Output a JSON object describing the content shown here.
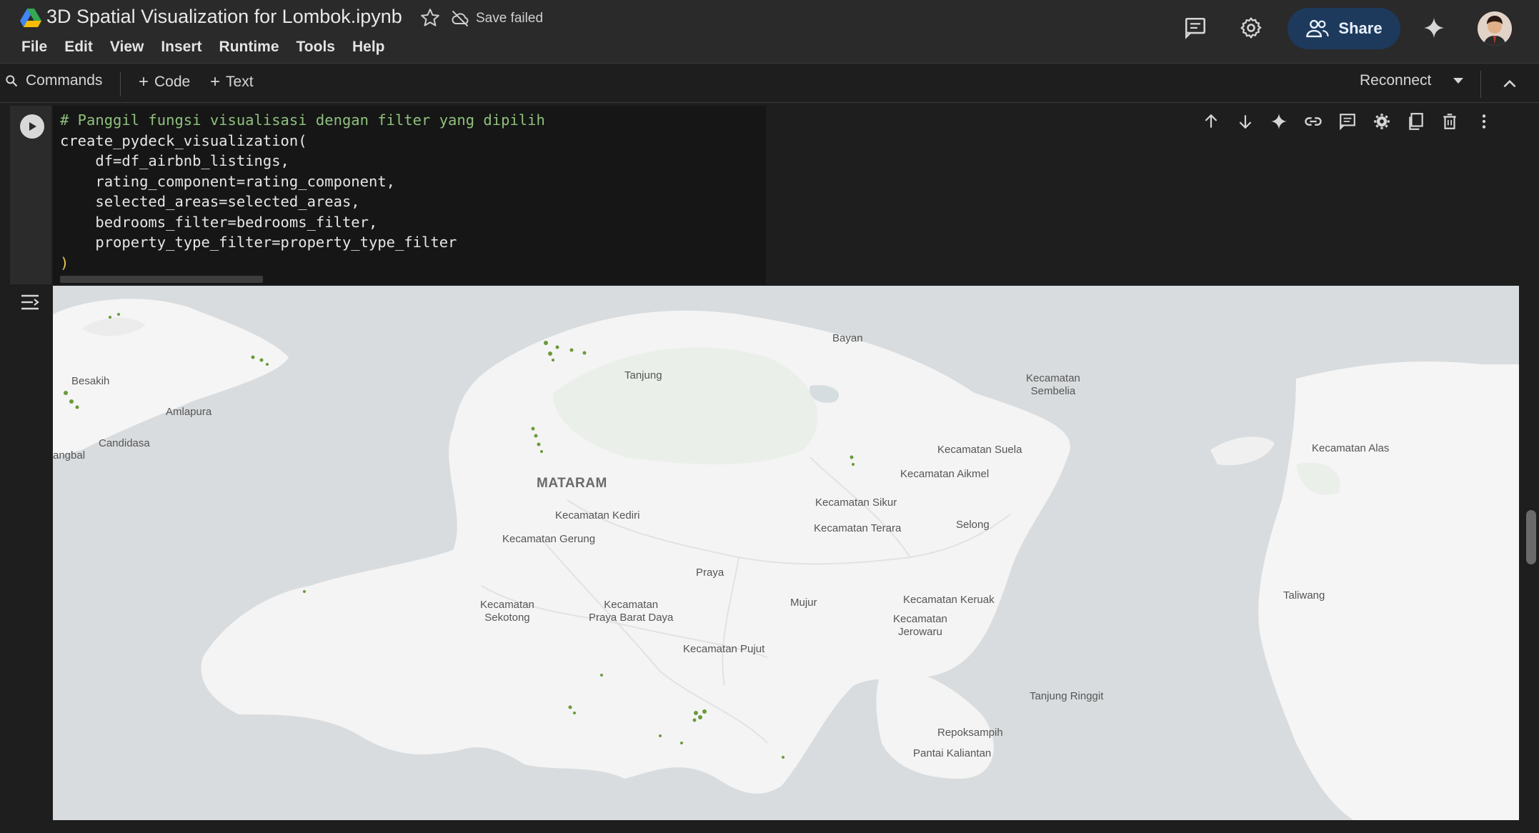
{
  "notebook": {
    "title": "3D Spatial Visualization for Lombok.ipynb",
    "save_status": "Save failed"
  },
  "menu": [
    "File",
    "Edit",
    "View",
    "Insert",
    "Runtime",
    "Tools",
    "Help"
  ],
  "header": {
    "share_label": "Share",
    "icons": [
      "comments-icon",
      "settings-gear-icon",
      "gemini-sparkle-icon"
    ]
  },
  "toolbar": {
    "commands_label": "Commands",
    "add_code_label": "Code",
    "add_text_label": "Text",
    "reconnect_label": "Reconnect"
  },
  "cell": {
    "code_lines": [
      "# Panggil fungsi visualisasi dengan filter yang dipilih",
      "create_pydeck_visualization(",
      "    df=df_airbnb_listings,",
      "    rating_component=rating_component,",
      "    selected_areas=selected_areas,",
      "    bedrooms_filter=bedrooms_filter,",
      "    property_type_filter=property_type_filter",
      ")"
    ],
    "toolbar_icons": [
      "move-up-icon",
      "move-down-icon",
      "gemini-sparkle-icon",
      "link-icon",
      "comment-icon",
      "cell-settings-icon",
      "mirror-cell-icon",
      "delete-icon",
      "more-vert-icon"
    ]
  },
  "map": {
    "places": [
      {
        "name": "Besakih",
        "cls": ""
      },
      {
        "name": "Amlapura",
        "cls": ""
      },
      {
        "name": "Candidasa",
        "cls": ""
      },
      {
        "name": "angbal",
        "cls": ""
      },
      {
        "name": "Tanjung",
        "cls": ""
      },
      {
        "name": "Bayan",
        "cls": ""
      },
      {
        "name": "Kecamatan\nSembelia",
        "cls": ""
      },
      {
        "name": "Kecamatan Suela",
        "cls": ""
      },
      {
        "name": "Kecamatan Aikmel",
        "cls": ""
      },
      {
        "name": "Kecamatan Alas",
        "cls": ""
      },
      {
        "name": "MATARAM",
        "cls": "city"
      },
      {
        "name": "Kecamatan Kediri",
        "cls": ""
      },
      {
        "name": "Kecamatan Sikur",
        "cls": ""
      },
      {
        "name": "Kecamatan Gerung",
        "cls": ""
      },
      {
        "name": "Kecamatan Terara",
        "cls": ""
      },
      {
        "name": "Selong",
        "cls": ""
      },
      {
        "name": "Praya",
        "cls": ""
      },
      {
        "name": "Mujur",
        "cls": ""
      },
      {
        "name": "Kecamatan Keruak",
        "cls": ""
      },
      {
        "name": "Kecamatan\nSekotong",
        "cls": ""
      },
      {
        "name": "Kecamatan\nPraya Barat Daya",
        "cls": ""
      },
      {
        "name": "Kecamatan\nJerowaru",
        "cls": ""
      },
      {
        "name": "Taliwang",
        "cls": ""
      },
      {
        "name": "Kecamatan Pujut",
        "cls": ""
      },
      {
        "name": "Tanjung Ringgit",
        "cls": ""
      },
      {
        "name": "Repoksampih",
        "cls": ""
      },
      {
        "name": "Pantai Kaliantan",
        "cls": ""
      }
    ]
  }
}
